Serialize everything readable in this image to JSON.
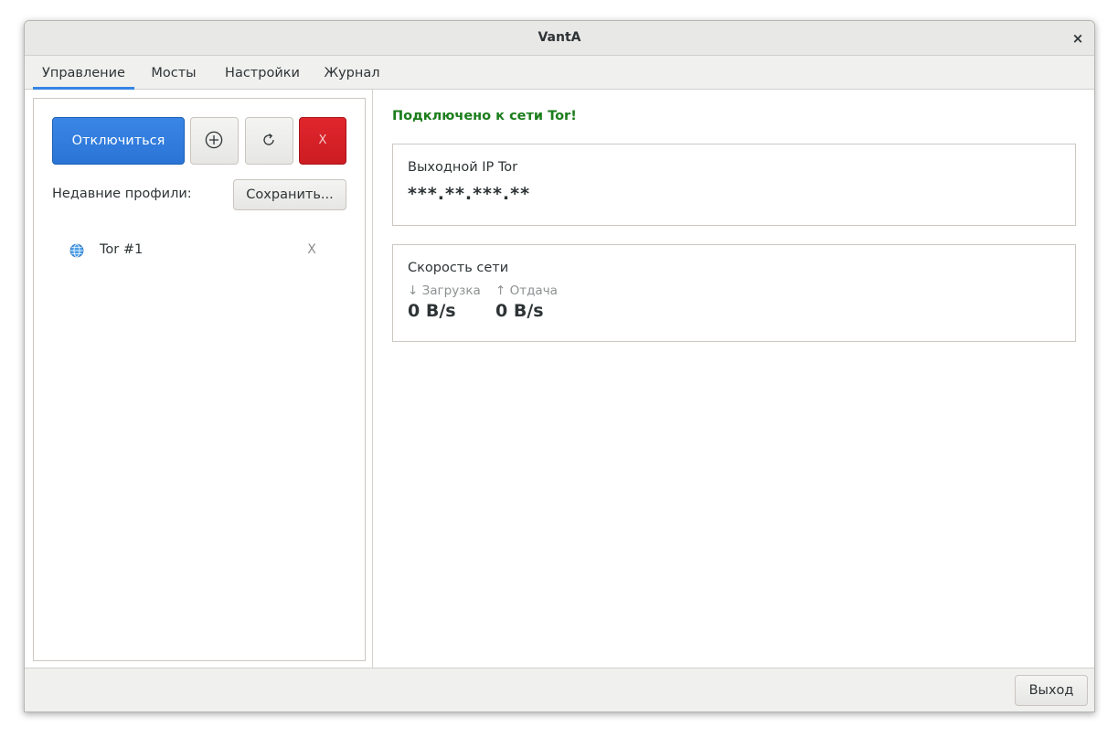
{
  "window": {
    "title": "VantA",
    "close_label": "×"
  },
  "tabs": [
    {
      "label": "Управление",
      "active": true
    },
    {
      "label": "Мосты",
      "active": false
    },
    {
      "label": "Настройки",
      "active": false
    },
    {
      "label": "Журнал",
      "active": false
    }
  ],
  "controls": {
    "disconnect_label": "Отключиться",
    "add_icon": "plus-circle-icon",
    "refresh_icon": "refresh-icon",
    "stop_label": "X"
  },
  "profiles": {
    "recent_label": "Недавние профили:",
    "save_label": "Сохранить...",
    "items": [
      {
        "name": "Tor #1",
        "icon": "globe-icon",
        "remove_label": "X"
      }
    ]
  },
  "status": {
    "text": "Подключено к сети Tor!",
    "color": "#1b7d1b"
  },
  "ip_card": {
    "title": "Выходной IP Tor",
    "value": "***.**.***.**"
  },
  "speed_card": {
    "title": "Скорость сети",
    "download_label": "↓ Загрузка",
    "download_value": "0 B/s",
    "upload_label": "↑ Отдача",
    "upload_value": "0 B/s"
  },
  "footer": {
    "exit_label": "Выход"
  },
  "colors": {
    "accent": "#3584e4",
    "danger": "#e01b24"
  }
}
